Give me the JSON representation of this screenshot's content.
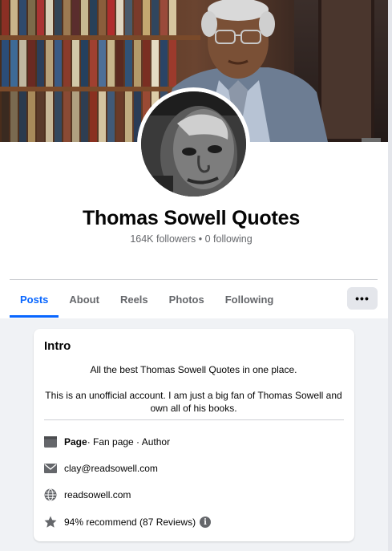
{
  "page": {
    "name": "Thomas Sowell Quotes",
    "stats": "164K followers • 0 following"
  },
  "tabs": [
    {
      "label": "Posts",
      "active": true
    },
    {
      "label": "About",
      "active": false
    },
    {
      "label": "Reels",
      "active": false
    },
    {
      "label": "Photos",
      "active": false
    },
    {
      "label": "Following",
      "active": false
    }
  ],
  "more_label": "•••",
  "intro": {
    "title": "Intro",
    "bio_line1": "All the best Thomas Sowell Quotes in one place.",
    "bio_line2": "This is an unofficial account. I am just a big fan of Thomas Sowell and own all of his books.",
    "category_bold": "Page",
    "category_rest": " · Fan page · Author",
    "email": "clay@readsowell.com",
    "website": "readsowell.com",
    "rating": "94% recommend (87 Reviews)",
    "info_glyph": "i"
  },
  "icons": [
    "page-flag-icon",
    "envelope-icon",
    "globe-icon",
    "star-icon",
    "info-icon"
  ],
  "colors": {
    "accent": "#0866ff",
    "muted": "#65676b",
    "surface": "#f0f2f5"
  }
}
